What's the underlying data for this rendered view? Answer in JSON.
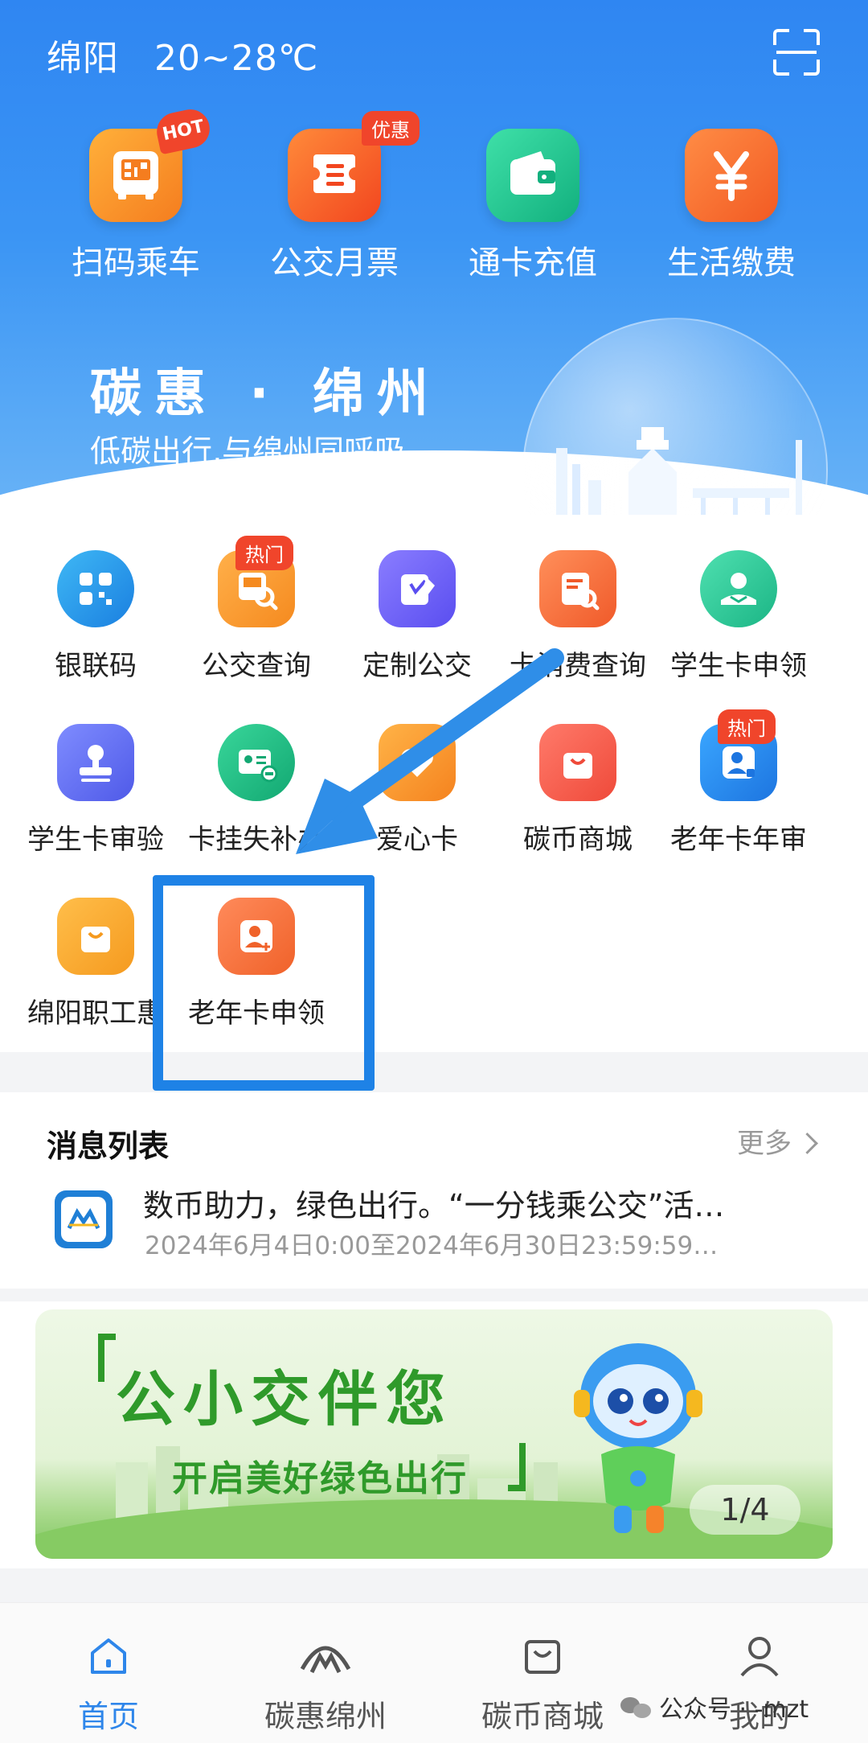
{
  "header": {
    "city": "绵阳",
    "temperature": "20~28℃"
  },
  "top_actions": [
    {
      "label": "扫码乘车",
      "icon": "bus-qr-icon",
      "badge": "HOT",
      "color": "#f57d1f"
    },
    {
      "label": "公交月票",
      "icon": "ticket-icon",
      "badge": "优惠",
      "color": "#f25a23"
    },
    {
      "label": "通卡充值",
      "icon": "wallet-icon",
      "badge": "",
      "color": "#1ec48f"
    },
    {
      "label": "生活缴费",
      "icon": "yen-icon",
      "badge": "",
      "color": "#f5672a"
    }
  ],
  "banner": {
    "title": "碳惠 · 绵州",
    "subtitle": "低碳出行,与绵州同呼吸"
  },
  "services": [
    {
      "label": "银联码",
      "icon": "unionpay-code-icon",
      "badge": ""
    },
    {
      "label": "公交查询",
      "icon": "bus-search-icon",
      "badge": "热门"
    },
    {
      "label": "定制公交",
      "icon": "custom-bus-icon",
      "badge": ""
    },
    {
      "label": "卡消费查询",
      "icon": "card-record-icon",
      "badge": ""
    },
    {
      "label": "学生卡申领",
      "icon": "student-card-icon",
      "badge": ""
    },
    {
      "label": "学生卡审验",
      "icon": "stamp-icon",
      "badge": ""
    },
    {
      "label": "卡挂失补办",
      "icon": "lost-card-icon",
      "badge": ""
    },
    {
      "label": "爱心卡",
      "icon": "heart-card-icon",
      "badge": ""
    },
    {
      "label": "碳币商城",
      "icon": "shopping-bag-icon",
      "badge": ""
    },
    {
      "label": "老年卡年审",
      "icon": "senior-review-icon",
      "badge": "热门"
    },
    {
      "label": "绵阳职工惠",
      "icon": "worker-bag-icon",
      "badge": ""
    },
    {
      "label": "老年卡申领",
      "icon": "senior-apply-icon",
      "badge": ""
    }
  ],
  "messages": {
    "title": "消息列表",
    "more": "更多",
    "item_title": "数币助力，绿色出行。“一分钱乘公交”活…",
    "item_detail": "2024年6月4日0:00至2024年6月30日23:59:59…"
  },
  "promo": {
    "title": "公小交伴您",
    "subtitle": "开启美好绿色出行",
    "pager": "1/4"
  },
  "tabs": [
    {
      "label": "首页",
      "icon": "home-icon",
      "active": true
    },
    {
      "label": "碳惠绵州",
      "icon": "carbon-logo-icon",
      "active": false
    },
    {
      "label": "碳币商城",
      "icon": "mall-bag-icon",
      "active": false
    },
    {
      "label": "我的",
      "icon": "profile-icon",
      "active": false
    }
  ],
  "watermark": "公众号 · -mzt",
  "colors": {
    "primary": "#2e86ea",
    "header_top": "#2f86f2",
    "highlight": "#1e82e6",
    "badge": "#f0452b"
  }
}
